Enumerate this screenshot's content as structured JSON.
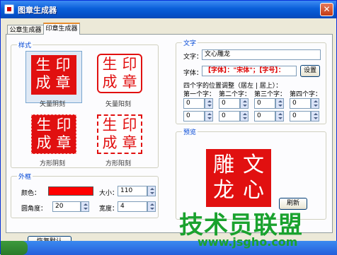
{
  "window": {
    "title": "图章生成器"
  },
  "tabs": [
    {
      "label": "公章生成器",
      "active": false
    },
    {
      "label": "印章生成器",
      "active": true
    }
  ],
  "style_group": {
    "legend": "样式",
    "seals": [
      {
        "chars": [
          "生",
          "印",
          "成",
          "章"
        ],
        "caption": "矢量阴刻",
        "kind": "solid",
        "selected": true
      },
      {
        "chars": [
          "生",
          "印",
          "成",
          "章"
        ],
        "caption": "矢量阳刻",
        "kind": "outline",
        "selected": false
      },
      {
        "chars": [
          "生",
          "印",
          "成",
          "章"
        ],
        "caption": "方形阴刻",
        "kind": "dotted-solid",
        "selected": false
      },
      {
        "chars": [
          "生",
          "印",
          "成",
          "章"
        ],
        "caption": "方形阳刻",
        "kind": "outline",
        "selected": false
      }
    ]
  },
  "outer_group": {
    "legend": "外框",
    "color_label": "颜色：",
    "color_value": "#ff0000",
    "size_label": "大小：",
    "size_value": "110",
    "radius_label": "圆角度：",
    "radius_value": "20",
    "width_label": "宽度：",
    "width_value": "4"
  },
  "text_group": {
    "legend": "文字",
    "text_label": "文字：",
    "text_value": "文心雕龙",
    "font_label": "字体：",
    "font_value": "【字体】：\"宋体\"；【字号】：",
    "settings_button": "设置",
    "adjust_label": "四个字的位置调整（居左 | 居上）：",
    "columns": [
      "第一个字：",
      "第二个字：",
      "第三个字：",
      "第四个字："
    ],
    "values": [
      [
        "0",
        "0"
      ],
      [
        "0",
        "0"
      ],
      [
        "0",
        "0"
      ],
      [
        "0",
        "0"
      ]
    ]
  },
  "preview_group": {
    "legend": "预览",
    "chars": [
      "雕",
      "文",
      "龙",
      "心"
    ],
    "refresh_button": "刷新"
  },
  "footer": {
    "reset_button": "恢复默认"
  },
  "watermark": {
    "text": "技术员联盟",
    "url": "www.jsgho.com"
  },
  "colors": {
    "seal_red": "#e11010",
    "title_blue": "#0a5fd9",
    "legend_blue": "#0046d5"
  }
}
